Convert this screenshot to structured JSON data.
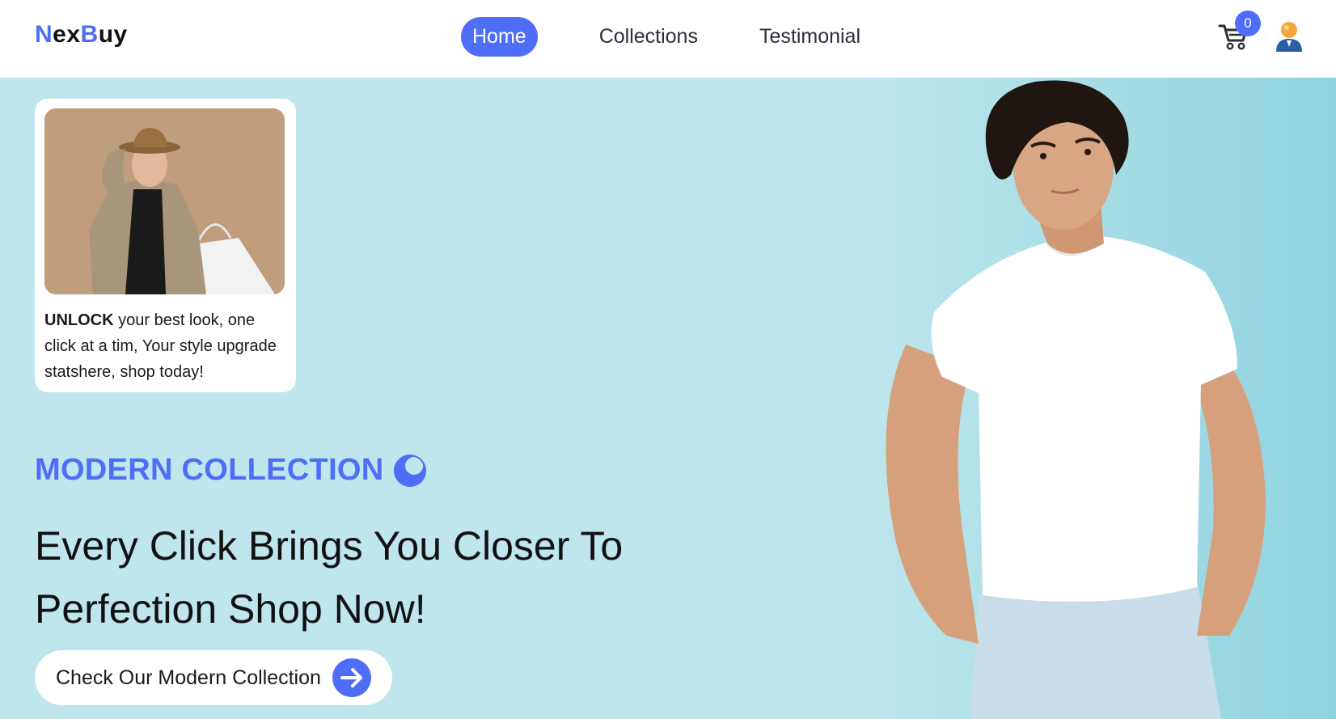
{
  "brand": {
    "logo_first": "N",
    "logo_second": "ex",
    "logo_third": "B",
    "logo_fourth": "uy"
  },
  "nav": {
    "links": [
      {
        "label": "Home",
        "active": true
      },
      {
        "label": "Collections",
        "active": false
      },
      {
        "label": "Testimonial",
        "active": false
      }
    ],
    "cart_count": "0",
    "cart_icon": "cart-icon",
    "user_icon": "user-avatar-icon"
  },
  "promo_card": {
    "bold": "UNLOCK",
    "text": " your best look, one click at a tim, Your style upgrade statshere, shop today!"
  },
  "hero": {
    "eyebrow": "MODERN COLLECTION",
    "eyebrow_icon": "moon-icon",
    "headline": "Every Click Brings You Closer To Perfection Shop Now!",
    "cta_label": "Check Our Modern Collection",
    "cta_icon": "arrow-right-circle-icon"
  },
  "colors": {
    "accent": "#4f6ef7",
    "hero_bg": "#bee6ec"
  }
}
